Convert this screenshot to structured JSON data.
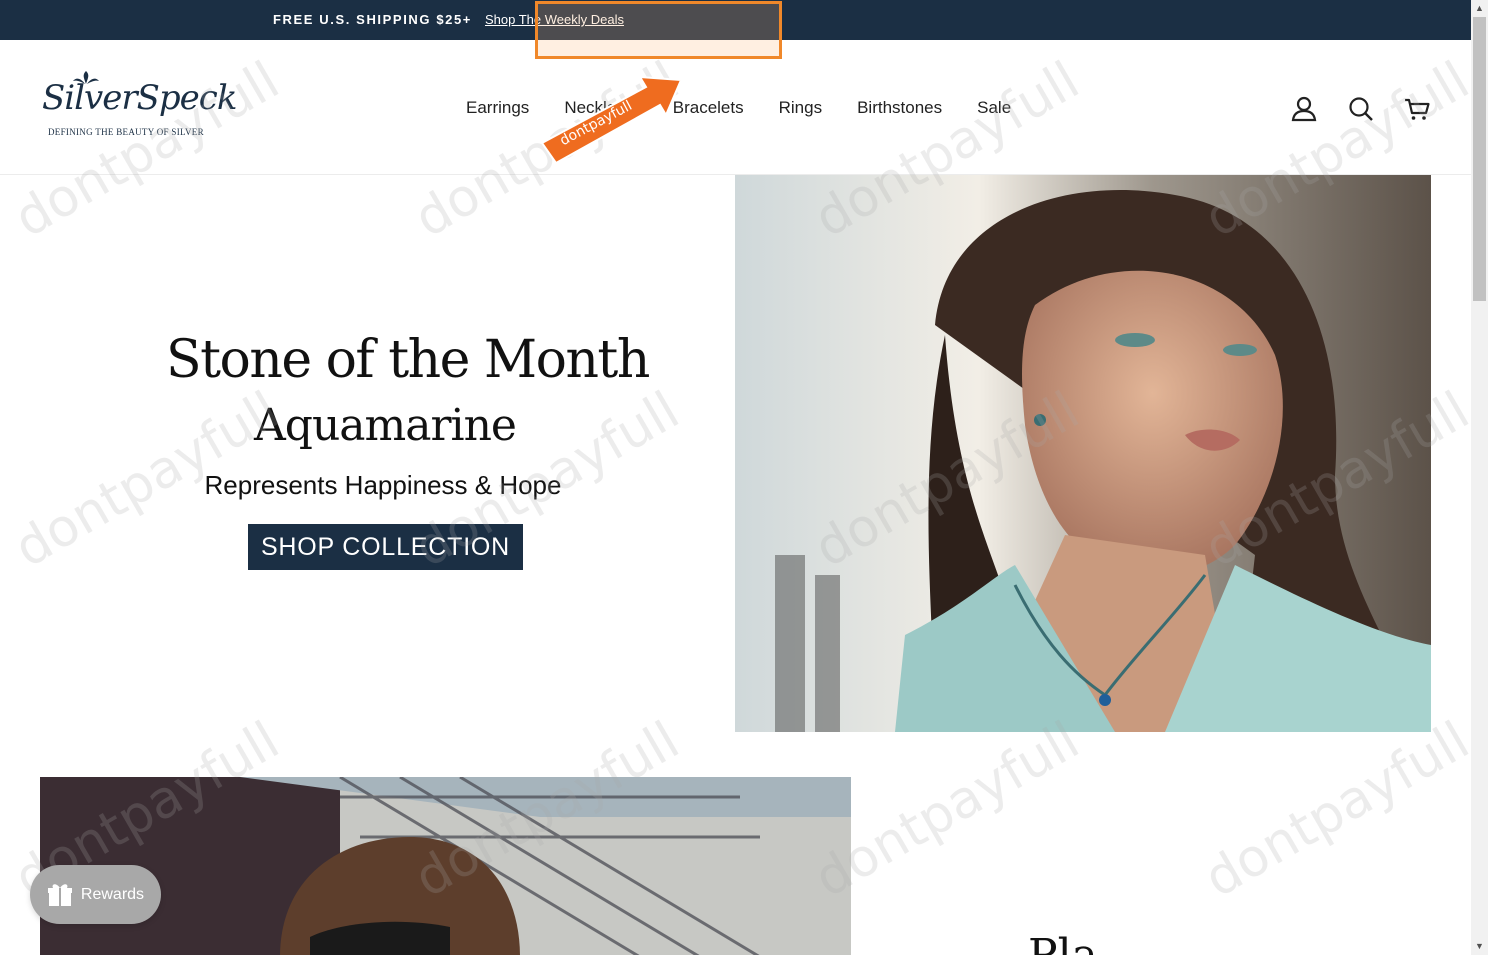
{
  "announcement": {
    "text": "FREE U.S. SHIPPING $25+",
    "link": "Shop The Weekly Deals"
  },
  "header": {
    "logo_name": "SilverSpeck",
    "logo_tagline": "DEFINING THE BEAUTY OF SILVER",
    "nav": [
      "Earrings",
      "Necklaces",
      "Bracelets",
      "Rings",
      "Birthstones",
      "Sale"
    ],
    "icons": [
      "account-icon",
      "search-icon",
      "cart-icon"
    ]
  },
  "hero": {
    "title": "Stone of the Month",
    "subtitle": "Aquamarine",
    "description": "Represents Happiness & Hope",
    "button": "SHOP COLLECTION"
  },
  "second_section": {
    "heading_partial": "Pla"
  },
  "rewards": {
    "label": "Rewards"
  },
  "overlay": {
    "badge": "dontpayfull",
    "watermark": "dontpayfull"
  },
  "colors": {
    "navy": "#1b2f44",
    "accent_orange": "#f0882a"
  }
}
